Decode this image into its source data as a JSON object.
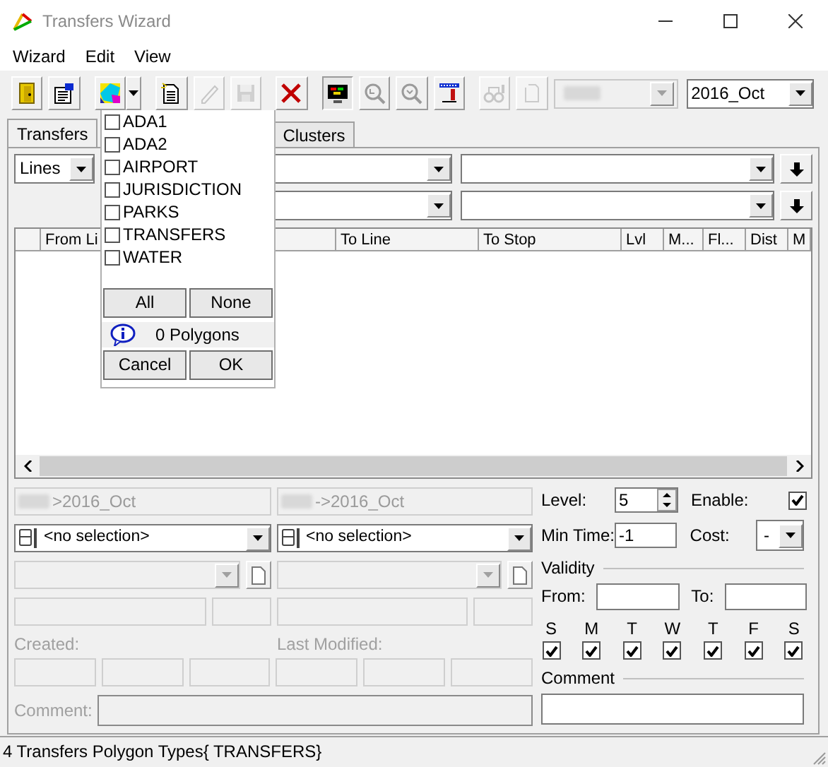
{
  "window": {
    "title": "Transfers Wizard"
  },
  "menu": [
    "Wizard",
    "Edit",
    "View"
  ],
  "toolbar": {
    "buttons": [
      {
        "kind": "plain",
        "disabled": false,
        "pressed": false
      },
      {
        "kind": "plain",
        "disabled": false,
        "pressed": false
      },
      {
        "kind": "split",
        "disabled": false,
        "pressed": false
      },
      {
        "kind": "plain",
        "disabled": false,
        "pressed": false
      },
      {
        "kind": "plain",
        "disabled": true,
        "pressed": false
      },
      {
        "kind": "plain",
        "disabled": true,
        "pressed": false
      },
      {
        "kind": "plain",
        "disabled": false,
        "pressed": false
      },
      {
        "kind": "plain",
        "disabled": false,
        "pressed": true
      },
      {
        "kind": "plain",
        "disabled": false,
        "pressed": false
      },
      {
        "kind": "plain",
        "disabled": false,
        "pressed": false
      },
      {
        "kind": "plain",
        "disabled": false,
        "pressed": false
      },
      {
        "kind": "plain",
        "disabled": true,
        "pressed": false
      },
      {
        "kind": "plain",
        "disabled": true,
        "pressed": false
      }
    ],
    "layer_dropdown": {
      "disabled": true
    },
    "period": "2016_Oct"
  },
  "tabs": [
    {
      "label": "Transfers",
      "selected": true
    },
    {
      "label": "Clusters",
      "selected": false
    }
  ],
  "filters": {
    "line_type": "Lines"
  },
  "grid": {
    "columns": [
      "From Li",
      "To Line",
      "To Stop",
      "Lvl",
      "M...",
      "Fl...",
      "Dist",
      "M"
    ]
  },
  "polygon_menu": {
    "items": [
      {
        "label": "ADA1",
        "checked": false
      },
      {
        "label": "ADA2",
        "checked": false
      },
      {
        "label": "AIRPORT",
        "checked": false
      },
      {
        "label": "JURISDICTION",
        "checked": false
      },
      {
        "label": "PARKS",
        "checked": false
      },
      {
        "label": "TRANSFERS",
        "checked": false
      },
      {
        "label": "WATER",
        "checked": false
      }
    ],
    "select_buttons": [
      "All",
      "None"
    ],
    "info": "0 Polygons",
    "actions": [
      "Cancel",
      "OK"
    ]
  },
  "details": {
    "from_period": ">2016_Oct",
    "to_period": "->2016_Oct",
    "from_stop": "<no selection>",
    "to_stop": "<no selection>",
    "created_label": "Created:",
    "modified_label": "Last Modified:",
    "comment_label": "Comment:"
  },
  "settings": {
    "level_label": "Level:",
    "level_value": "5",
    "enable_label": "Enable:",
    "enabled": true,
    "min_time_label": "Min Time:",
    "min_time": "-1",
    "cost_label": "Cost:",
    "cost": "-",
    "validity_label": "Validity",
    "from_label": "From:",
    "to_label": "To:",
    "days": [
      {
        "label": "S",
        "checked": true
      },
      {
        "label": "M",
        "checked": true
      },
      {
        "label": "T",
        "checked": true
      },
      {
        "label": "W",
        "checked": true
      },
      {
        "label": "T",
        "checked": true
      },
      {
        "label": "F",
        "checked": true
      },
      {
        "label": "S",
        "checked": true
      }
    ],
    "comment_label": "Comment"
  },
  "status_bar": "4 Transfers Polygon Types{ TRANSFERS}"
}
